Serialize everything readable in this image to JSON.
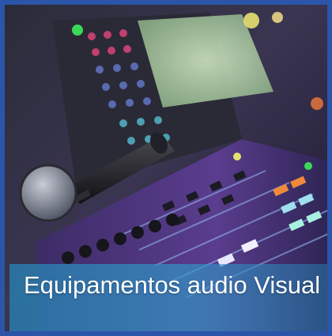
{
  "tile": {
    "caption": "Equipamentos audio Visual",
    "image_subject": "audio mixing console with microphone",
    "colors": {
      "border": "#2b55a8",
      "caption_band": "#2a86b8",
      "caption_text": "#ffffff"
    }
  }
}
